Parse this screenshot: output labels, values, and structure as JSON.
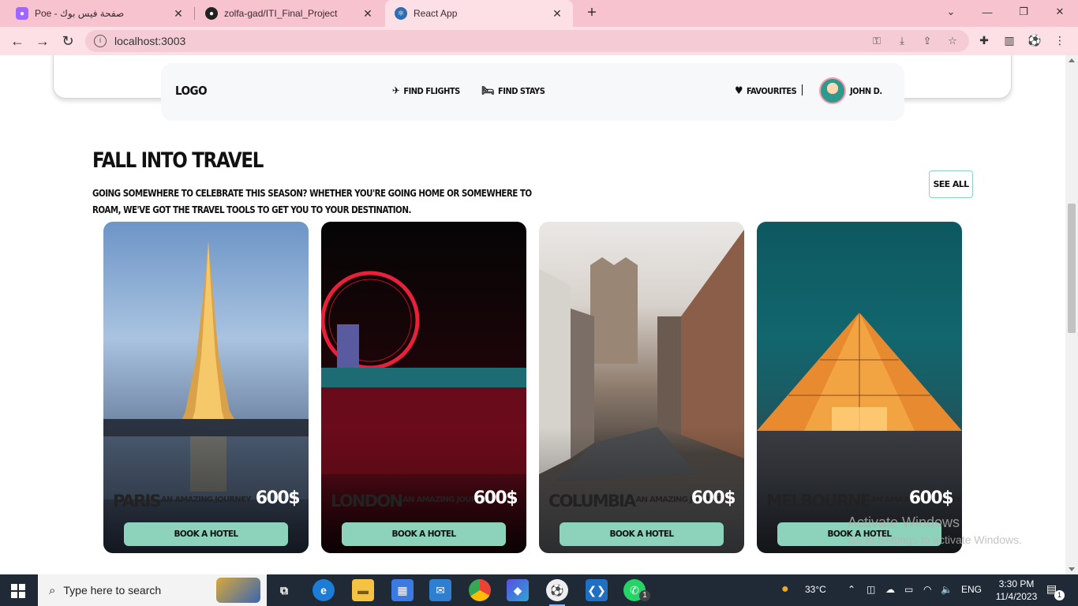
{
  "browser": {
    "tabs": [
      {
        "title": "Poe - صفحة فيس بوك",
        "icon": "poe-icon",
        "color": "#a066ff"
      },
      {
        "title": "zolfa-gad/ITI_Final_Project",
        "icon": "github-icon",
        "color": "#222222"
      },
      {
        "title": "React App",
        "icon": "react-icon",
        "color": "#2b6db3"
      }
    ],
    "address": "localhost:3003"
  },
  "nav": {
    "logo": "LOGO",
    "flights": "FIND FLIGHTS",
    "stays": "FIND STAYS",
    "favourites": "FAVOURITES",
    "divider": "|",
    "user": "JOHN D."
  },
  "section": {
    "title": "FALL INTO TRAVEL",
    "description": "GOING SOMEWHERE TO CELEBRATE THIS SEASON? WHETHER YOU'RE GOING HOME OR SOMEWHERE TO ROAM, WE'VE GOT THE TRAVEL TOOLS TO GET YOU TO YOUR DESTINATION.",
    "see_all": "SEE ALL"
  },
  "cards": [
    {
      "city": "PARIS",
      "tagline": "AN AMAZING JOURNEY",
      "price": "600$",
      "button": "BOOK A HOTEL"
    },
    {
      "city": "LONDON",
      "tagline": "AN AMAZING JOURNEY",
      "price": "600$",
      "button": "BOOK A HOTEL"
    },
    {
      "city": "COLUMBIA",
      "tagline": "AN AMAZING JOURNEY",
      "price": "600$",
      "button": "BOOK A HOTEL"
    },
    {
      "city": "MELBOURNE",
      "tagline": "AN AMAZING JOURNEY",
      "price": "600$",
      "button": "BOOK A HOTEL"
    }
  ],
  "watermark": {
    "line1": "Activate Windows",
    "line2": "Go to Settings to activate Windows."
  },
  "taskbar": {
    "search_placeholder": "Type here to search",
    "weather": "33°C",
    "language": "ENG",
    "time": "3:30 PM",
    "date": "11/4/2023",
    "notifications": "1",
    "whatsapp_badge": "1"
  },
  "colors": {
    "accent": "#8dd3bb",
    "tabbar": "#f7c3cf",
    "taskbar": "#1f2a36"
  }
}
